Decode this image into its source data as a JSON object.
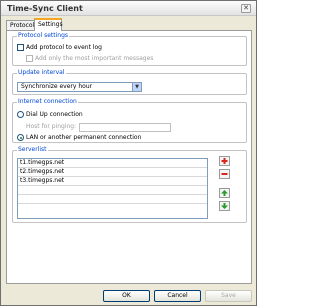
{
  "window": {
    "title": "Time-Sync Client"
  },
  "tabs": [
    {
      "label": "Protocol",
      "active": false
    },
    {
      "label": "Settings",
      "active": true
    }
  ],
  "protocol_settings": {
    "title": "Protocol settings",
    "add_to_event_log": {
      "label": "Add protocol to event log",
      "checked": false
    },
    "only_important": {
      "label": "Add only the most important messages",
      "checked": false,
      "enabled": false
    }
  },
  "update_interval": {
    "title": "Update interval",
    "selected": "Synchronize every hour"
  },
  "internet_connection": {
    "title": "Internet connection",
    "dial_up": {
      "label": "Dial Up connection",
      "selected": false
    },
    "host_label": "Host for pinging:",
    "host_value": "",
    "lan": {
      "label": "LAN or another permanent connection",
      "selected": true
    }
  },
  "serverlist": {
    "title": "Serverlist",
    "servers": [
      "t1.timegps.net",
      "t2.timegps.net",
      "t3.timegps.net",
      "",
      "",
      ""
    ]
  },
  "buttons": {
    "ok": "OK",
    "cancel": "Cancel",
    "save": "Save"
  },
  "colors": {
    "group_title": "#0046d5",
    "tab_accent": "#f5a623",
    "add_icon": "#d9261c",
    "remove_icon": "#d9261c",
    "move_icons": "#2a9a2a"
  }
}
